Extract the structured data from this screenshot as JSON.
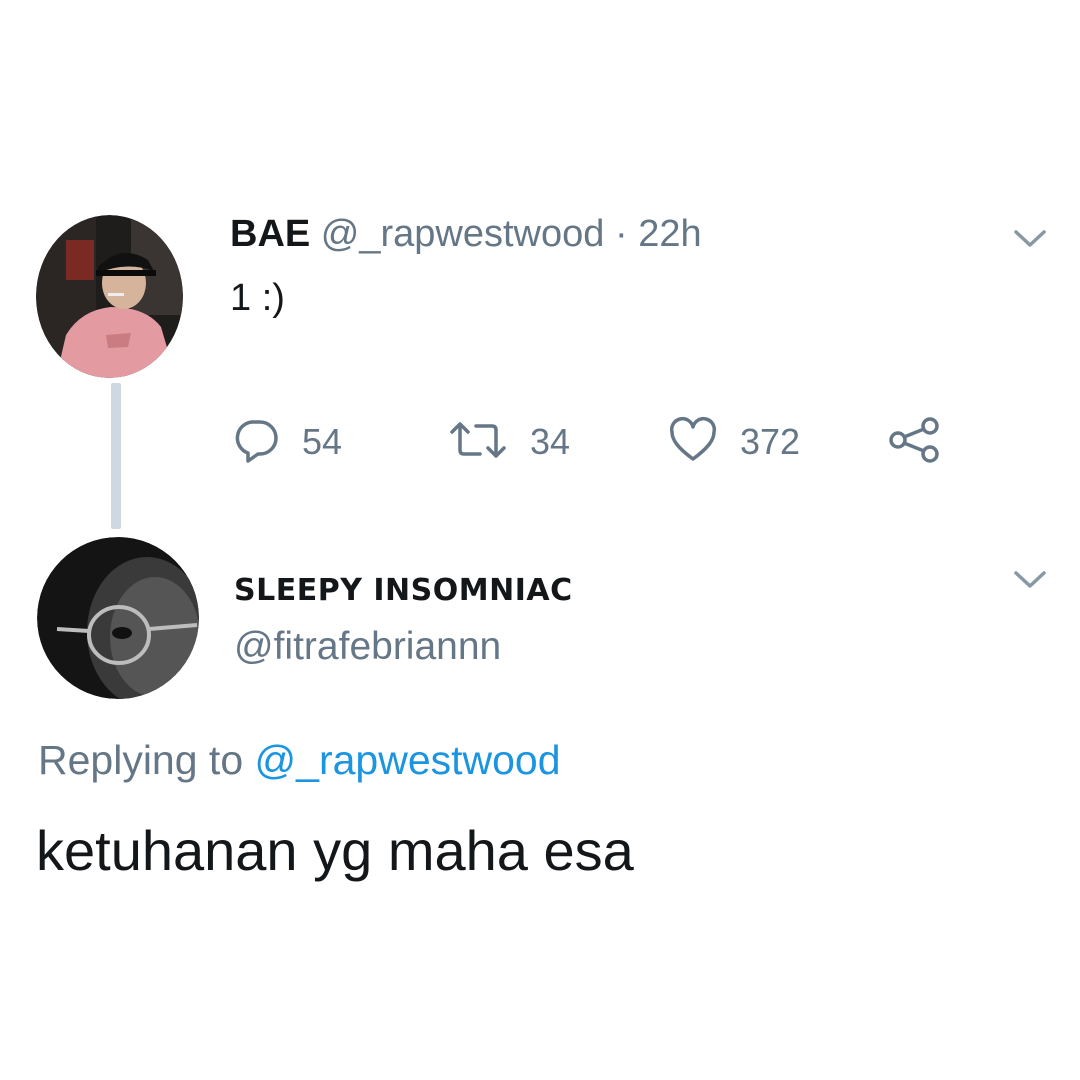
{
  "tweet": {
    "display_name": "BAE",
    "handle": "@_rapwestwood",
    "separator": "·",
    "time": "22h",
    "text": "1 :)",
    "reply_count": "54",
    "retweet_count": "34",
    "like_count": "372"
  },
  "reply": {
    "display_name": "SLEEPY INSOMNIAC",
    "handle": "@fitrafebriannn",
    "replying_prefix": "Replying to",
    "replying_mention": "@_rapwestwood",
    "text": "ketuhanan yg maha esa"
  },
  "colors": {
    "text_primary": "#14171a",
    "text_secondary": "#657786",
    "link": "#1b95e0",
    "thread_line": "#cfd8e0"
  },
  "icons": {
    "reply": "reply-bubble",
    "retweet": "retweet-arrows",
    "like": "heart-outline",
    "share": "share-nodes",
    "menu": "chevron-down"
  }
}
